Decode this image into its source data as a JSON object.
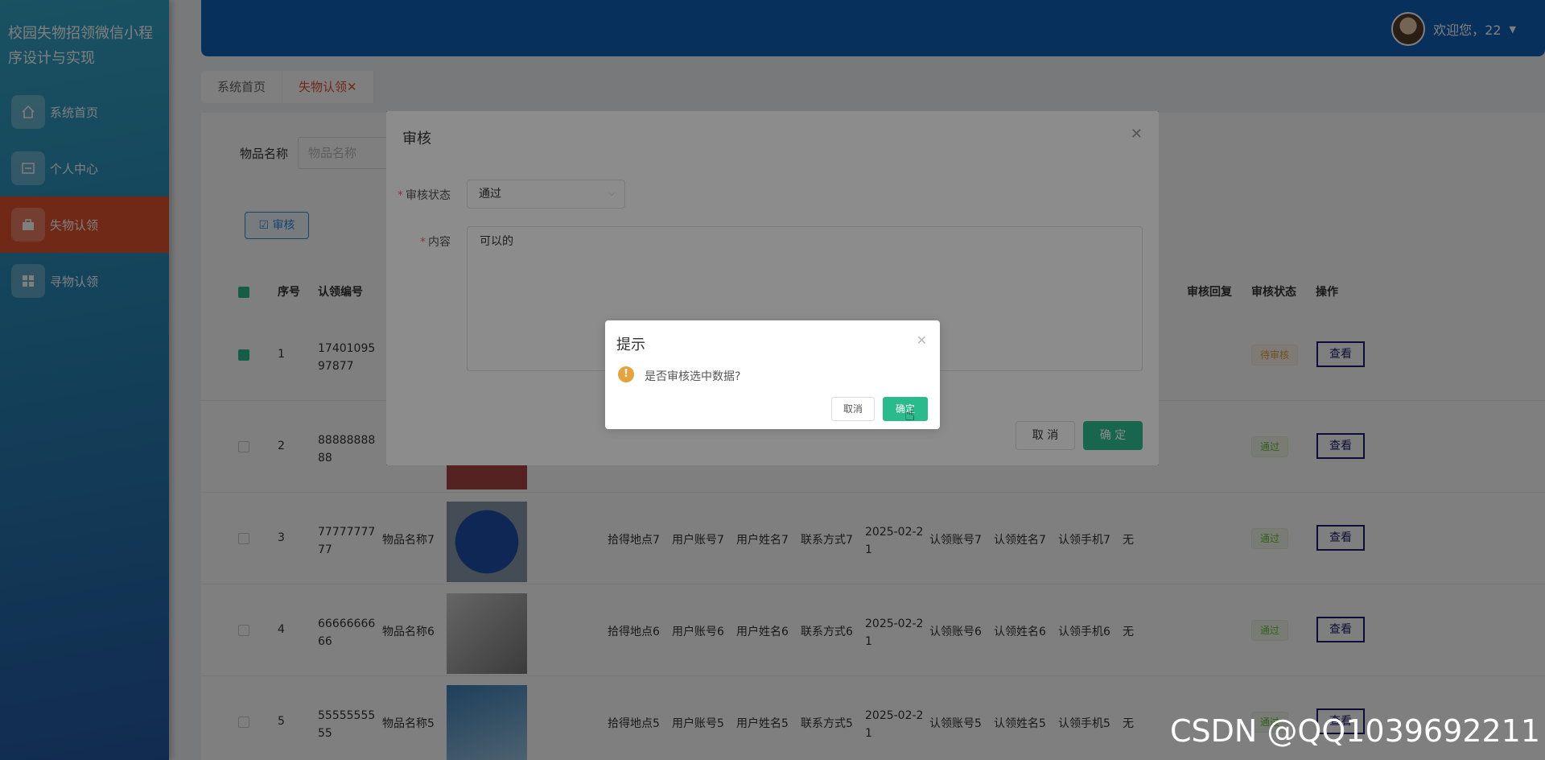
{
  "sidebar": {
    "brand": "校园失物招领微信小程序设计与实现",
    "items": [
      {
        "label": "系统首页",
        "icon": "home-icon"
      },
      {
        "label": "个人中心",
        "icon": "profile-icon"
      },
      {
        "label": "失物认领",
        "icon": "briefcase-icon",
        "active": true
      },
      {
        "label": "寻物认领",
        "icon": "grid-icon"
      }
    ]
  },
  "header": {
    "welcome": "欢迎您，22"
  },
  "tabs": [
    {
      "label": "系统首页"
    },
    {
      "label": "失物认领✕"
    }
  ],
  "filter": {
    "label": "物品名称",
    "placeholder": "物品名称"
  },
  "toolbar": {
    "audit_label": "审核"
  },
  "table": {
    "columns": {
      "idx": "序号",
      "code": "认领编号",
      "reply": "审核回复",
      "status": "审核状态",
      "ops": "操作"
    },
    "rows": [
      {
        "idx": "1",
        "code": "1740109597877",
        "status": "待审核",
        "checked": true
      },
      {
        "idx": "2",
        "code": "8888888888",
        "status": "通过"
      },
      {
        "idx": "3",
        "code": "7777777777",
        "name": "物品名称7",
        "place": "拾得地点7",
        "acct": "用户账号7",
        "uname": "用户姓名7",
        "contact": "联系方式7",
        "date": "2025-02-21",
        "cacct": "认领账号7",
        "cname": "认领姓名7",
        "cphone": "认领手机7",
        "reply": "无",
        "status": "通过"
      },
      {
        "idx": "4",
        "code": "6666666666",
        "name": "物品名称6",
        "place": "拾得地点6",
        "acct": "用户账号6",
        "uname": "用户姓名6",
        "contact": "联系方式6",
        "date": "2025-02-21",
        "cacct": "认领账号6",
        "cname": "认领姓名6",
        "cphone": "认领手机6",
        "reply": "无",
        "status": "通过"
      },
      {
        "idx": "5",
        "code": "5555555555",
        "name": "物品名称5",
        "place": "拾得地点5",
        "acct": "用户账号5",
        "uname": "用户姓名5",
        "contact": "联系方式5",
        "date": "2025-02-21",
        "cacct": "认领账号5",
        "cname": "认领姓名5",
        "cphone": "认领手机5",
        "reply": "无",
        "status": "通过"
      }
    ],
    "view_label": "查看"
  },
  "dialog": {
    "title": "审核",
    "status_label": "审核状态",
    "status_value": "通过",
    "content_label": "内容",
    "content_value": "可以的",
    "cancel_label": "取 消",
    "ok_label": "确 定"
  },
  "confirm": {
    "title": "提示",
    "message": "是否审核选中数据?",
    "cancel_label": "取消",
    "ok_label": "确定"
  },
  "watermark": "CSDN @QQ1039692211"
}
